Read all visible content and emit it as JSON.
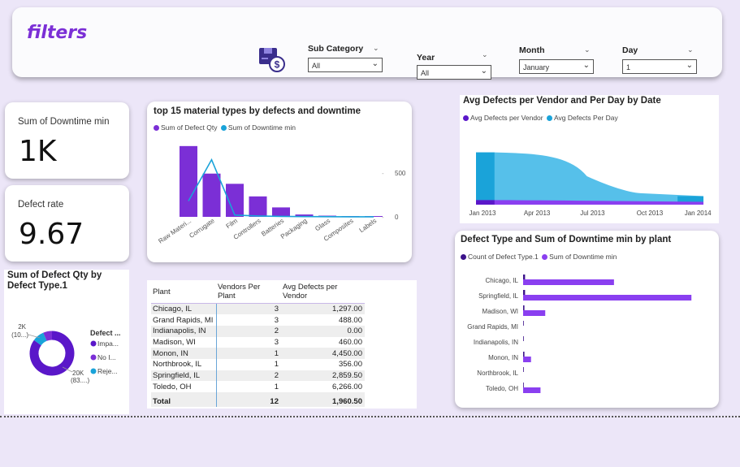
{
  "filters": {
    "title": "filters",
    "icon": "package-dollar-icon",
    "slicers": [
      {
        "label": "Sub Category",
        "value": "All"
      },
      {
        "label": "Year",
        "value": "All"
      },
      {
        "label": "Month",
        "value": "January"
      },
      {
        "label": "Day",
        "value": "1"
      }
    ]
  },
  "kpis": {
    "downtime": {
      "label": "Sum of Downtime min",
      "value": "1K"
    },
    "defect_rate": {
      "label": "Defect rate",
      "value": "9.67"
    }
  },
  "colors": {
    "purple": "#7b2fd6",
    "dark_purple": "#5a17c9",
    "blue": "#1aa3d9",
    "light_blue": "#56c0ea",
    "background": "#ece6f8"
  },
  "chart_data": [
    {
      "id": "material_types",
      "type": "bar",
      "title": "top 15 material types by defects and downtime",
      "legend": [
        "Sum of Defect Qty",
        "Sum of Downtime min"
      ],
      "categories": [
        "Raw Materi...",
        "Corrugate",
        "Film",
        "Controllers",
        "Batteries",
        "Packaging",
        "Glass",
        "Composites",
        "Labels"
      ],
      "series": [
        {
          "name": "Sum of Defect Qty",
          "kind": "bar",
          "values": [
            90,
            55,
            42,
            26,
            12,
            3,
            1.5,
            1,
            1
          ]
        },
        {
          "name": "Sum of Downtime min",
          "kind": "line",
          "values": [
            180,
            650,
            20,
            10,
            5,
            3,
            2,
            1,
            1
          ]
        }
      ],
      "secondary_axis_ticks": [
        "500",
        "0"
      ],
      "y2lim": [
        0,
        850
      ]
    },
    {
      "id": "vendor_day",
      "type": "area",
      "title": "Avg Defects per Vendor and Per Day by Date",
      "legend": [
        "Avg Defects per Vendor",
        "Avg Defects Per Day"
      ],
      "x_ticks": [
        "Jan 2013",
        "Apr 2013",
        "Jul 2013",
        "Oct 2013",
        "Jan 2014"
      ],
      "x": [
        0,
        1,
        3,
        6,
        9,
        12
      ],
      "series": [
        {
          "name": "Avg Defects per Vendor",
          "values": [
            8,
            8,
            8,
            7,
            6,
            5
          ]
        },
        {
          "name": "Avg Defects Per Day",
          "values": [
            92,
            92,
            90,
            50,
            20,
            15
          ]
        }
      ],
      "ylim": [
        0,
        100
      ]
    },
    {
      "id": "defect_type_donut",
      "type": "pie",
      "title": "Sum of Defect Qty by Defect Type.1",
      "legend_title": "Defect ...",
      "slices": [
        {
          "label": "Impa...",
          "value": 20000,
          "color": "#5a17c9"
        },
        {
          "label": "No I...",
          "value": 1500,
          "color": "#7b2fd6"
        },
        {
          "label": "Reje...",
          "value": 2000,
          "color": "#1aa3d9"
        }
      ],
      "data_labels": [
        {
          "line1": "2K",
          "line2": "(10...)"
        },
        {
          "line1": "20K",
          "line2": "(83....)"
        }
      ]
    },
    {
      "id": "plant_bars",
      "type": "bar",
      "orientation": "horizontal",
      "title": "Defect Type and Sum of Downtime min by plant",
      "legend": [
        "Count of Defect Type.1",
        "Sum of Downtime min"
      ],
      "categories": [
        "Chicago, IL",
        "Springfield, IL",
        "Madison, WI",
        "Grand Rapids, MI",
        "Indianapolis, IN",
        "Monon, IN",
        "Northbrook, IL",
        "Toledo, OH"
      ],
      "series": [
        {
          "name": "Count of Defect Type.1",
          "values": [
            3,
            3,
            2,
            1,
            1,
            2,
            1,
            1
          ]
        },
        {
          "name": "Sum of Downtime min",
          "values": [
            115,
            213,
            28,
            0,
            0,
            10,
            0,
            22
          ]
        }
      ],
      "xlim": [
        0,
        220
      ]
    }
  ],
  "table": {
    "headers": [
      "Plant",
      "Vendors Per Plant",
      "Avg Defects per Vendor"
    ],
    "rows": [
      [
        "Chicago, IL",
        "3",
        "1,297.00"
      ],
      [
        "Grand Rapids, MI",
        "3",
        "488.00"
      ],
      [
        "Indianapolis, IN",
        "2",
        "0.00"
      ],
      [
        "Madison, WI",
        "3",
        "460.00"
      ],
      [
        "Monon, IN",
        "1",
        "4,450.00"
      ],
      [
        "Northbrook, IL",
        "1",
        "356.00"
      ],
      [
        "Springfield, IL",
        "2",
        "2,859.50"
      ],
      [
        "Toledo, OH",
        "1",
        "6,266.00"
      ]
    ],
    "total": [
      "Total",
      "12",
      "1,960.50"
    ]
  }
}
